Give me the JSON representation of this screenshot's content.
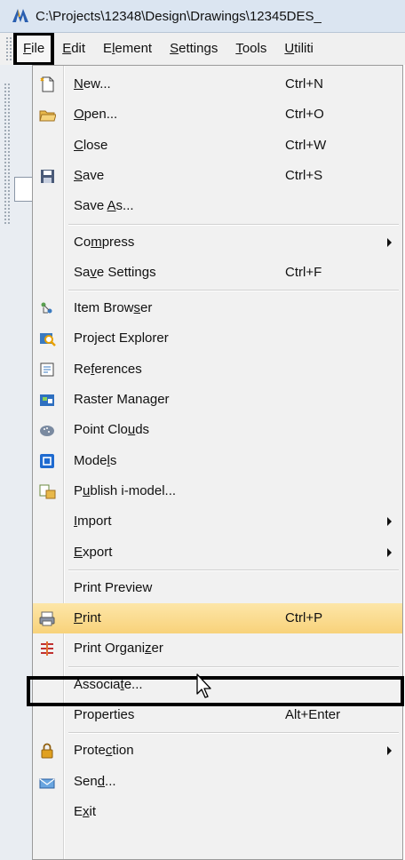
{
  "window": {
    "title": "C:\\Projects\\12348\\Design\\Drawings\\12345DES_"
  },
  "menubar": {
    "items": [
      {
        "name": "menu-file",
        "pre": "",
        "u": "F",
        "post": "ile"
      },
      {
        "name": "menu-edit",
        "pre": "",
        "u": "E",
        "post": "dit"
      },
      {
        "name": "menu-element",
        "pre": "E",
        "u": "l",
        "post": "ement"
      },
      {
        "name": "menu-settings",
        "pre": "",
        "u": "S",
        "post": "ettings"
      },
      {
        "name": "menu-tools",
        "pre": "",
        "u": "T",
        "post": "ools"
      },
      {
        "name": "menu-utilities",
        "pre": "",
        "u": "U",
        "post": "tiliti"
      }
    ]
  },
  "file_menu": {
    "items": [
      {
        "pre": "",
        "u": "N",
        "post": "ew...",
        "shortcut": "Ctrl+N",
        "icon": "new-file-icon"
      },
      {
        "pre": "",
        "u": "O",
        "post": "pen...",
        "shortcut": "Ctrl+O",
        "icon": "open-folder-icon"
      },
      {
        "pre": "",
        "u": "C",
        "post": "lose",
        "shortcut": "Ctrl+W"
      },
      {
        "pre": "",
        "u": "S",
        "post": "ave",
        "shortcut": "Ctrl+S",
        "icon": "save-disk-icon"
      },
      {
        "pre": "Save ",
        "u": "A",
        "post": "s...",
        "shortcut": ""
      },
      {
        "pre": "Co",
        "u": "m",
        "post": "press",
        "shortcut": "",
        "submenu": true
      },
      {
        "pre": "Sa",
        "u": "v",
        "post": "e Settings",
        "shortcut": "Ctrl+F"
      },
      {
        "pre": "Item Brow",
        "u": "s",
        "post": "er",
        "shortcut": "",
        "icon": "item-browser-icon"
      },
      {
        "pre": "Pro",
        "u": "j",
        "post": "ect Explorer",
        "shortcut": "",
        "icon": "project-explorer-icon"
      },
      {
        "pre": "Re",
        "u": "f",
        "post": "erences",
        "shortcut": "",
        "icon": "references-icon"
      },
      {
        "pre": "Raster Mana",
        "u": "g",
        "post": "er",
        "shortcut": "",
        "icon": "raster-manager-icon"
      },
      {
        "pre": "Point Clo",
        "u": "u",
        "post": "ds",
        "shortcut": "",
        "icon": "point-clouds-icon"
      },
      {
        "pre": "Mode",
        "u": "l",
        "post": "s",
        "shortcut": "",
        "icon": "models-icon"
      },
      {
        "pre": "P",
        "u": "u",
        "post": "blish i-model...",
        "shortcut": "",
        "icon": "publish-imodel-icon"
      },
      {
        "pre": "",
        "u": "I",
        "post": "mport",
        "shortcut": "",
        "submenu": true
      },
      {
        "pre": "",
        "u": "E",
        "post": "xport",
        "shortcut": "",
        "submenu": true
      },
      {
        "pre": "Print Preview",
        "u": "",
        "post": "",
        "shortcut": ""
      },
      {
        "pre": "",
        "u": "P",
        "post": "rint",
        "shortcut": "Ctrl+P",
        "icon": "printer-icon",
        "highlighted": true
      },
      {
        "pre": "Print Organi",
        "u": "z",
        "post": "er",
        "shortcut": "",
        "icon": "print-organizer-icon"
      },
      {
        "pre": "Associa",
        "u": "t",
        "post": "e...",
        "shortcut": ""
      },
      {
        "pre": "Properties",
        "u": "",
        "post": "",
        "shortcut": "Alt+Enter"
      },
      {
        "pre": "Prote",
        "u": "c",
        "post": "tion",
        "shortcut": "",
        "icon": "lock-icon",
        "submenu": true
      },
      {
        "pre": "Sen",
        "u": "d",
        "post": "...",
        "shortcut": "",
        "icon": "send-icon"
      },
      {
        "pre": "E",
        "u": "x",
        "post": "it",
        "shortcut": ""
      }
    ]
  },
  "colors": {
    "highlight_top": "#fde6a8",
    "highlight_bottom": "#f8d27a",
    "menu_bg": "#f1f1f1"
  }
}
